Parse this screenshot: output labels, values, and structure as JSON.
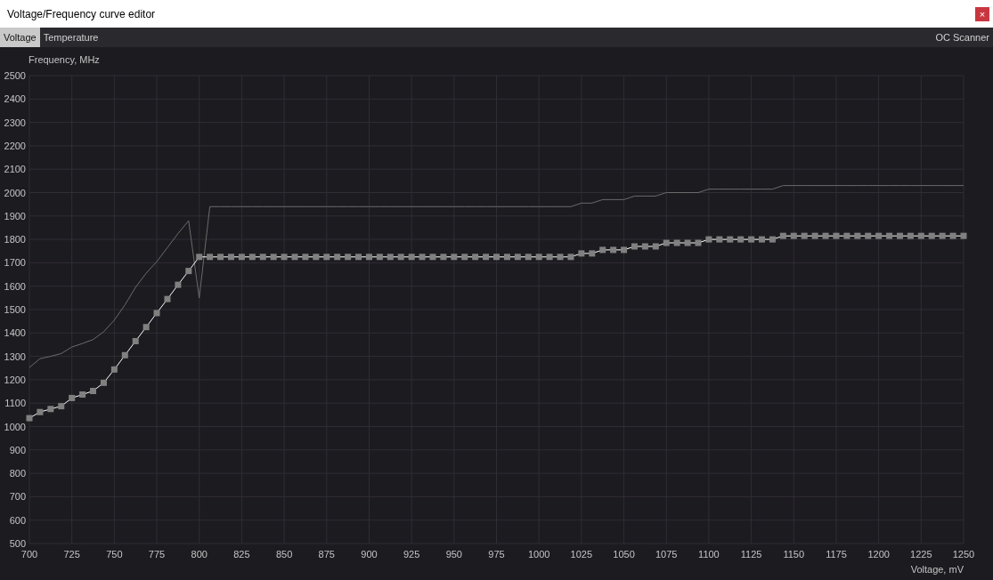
{
  "window": {
    "title": "Voltage/Frequency curve editor",
    "close": "×"
  },
  "tabs": [
    {
      "label": "Voltage",
      "selected": true
    },
    {
      "label": "Temperature",
      "selected": false
    }
  ],
  "oc_scanner": "OC Scanner",
  "chart_data": {
    "type": "line",
    "xlabel": "Voltage, mV",
    "ylabel": "Frequency, MHz",
    "grid": true,
    "xlim": [
      700,
      1250
    ],
    "ylim": [
      500,
      2500
    ],
    "xticks": [
      700,
      725,
      750,
      775,
      800,
      825,
      850,
      875,
      900,
      925,
      950,
      975,
      1000,
      1025,
      1050,
      1075,
      1100,
      1125,
      1150,
      1175,
      1200,
      1225,
      1250
    ],
    "yticks": [
      500,
      600,
      700,
      800,
      900,
      1000,
      1100,
      1200,
      1300,
      1400,
      1500,
      1600,
      1700,
      1800,
      1900,
      2000,
      2100,
      2200,
      2300,
      2400,
      2500
    ],
    "x": [
      700,
      706.25,
      712.5,
      718.75,
      725,
      731.25,
      737.5,
      743.75,
      750,
      756.25,
      762.5,
      768.75,
      775,
      781.25,
      787.5,
      793.75,
      800,
      806.25,
      812.5,
      818.75,
      825,
      831.25,
      837.5,
      843.75,
      850,
      856.25,
      862.5,
      868.75,
      875,
      881.25,
      887.5,
      893.75,
      900,
      906.25,
      912.5,
      918.75,
      925,
      931.25,
      937.5,
      943.75,
      950,
      956.25,
      962.5,
      968.75,
      975,
      981.25,
      987.5,
      993.75,
      1000,
      1006.25,
      1012.5,
      1018.75,
      1025,
      1031.25,
      1037.5,
      1043.75,
      1050,
      1056.25,
      1062.5,
      1068.75,
      1075,
      1081.25,
      1087.5,
      1093.75,
      1100,
      1106.25,
      1112.5,
      1118.75,
      1125,
      1131.25,
      1137.5,
      1143.75,
      1150,
      1156.25,
      1162.5,
      1168.75,
      1175,
      1181.25,
      1187.5,
      1193.75,
      1200,
      1206.25,
      1212.5,
      1218.75,
      1225,
      1231.25,
      1237.5,
      1243.75,
      1250
    ],
    "series": [
      {
        "color": "#ffffff",
        "marker": "square",
        "values": [
          1036,
          1062,
          1075,
          1087,
          1122,
          1137,
          1152,
          1187,
          1244,
          1305,
          1365,
          1425,
          1485,
          1545,
          1606,
          1665,
          1725,
          1725,
          1725,
          1725,
          1725,
          1725,
          1725,
          1725,
          1725,
          1725,
          1725,
          1725,
          1725,
          1725,
          1725,
          1725,
          1725,
          1725,
          1725,
          1725,
          1725,
          1725,
          1725,
          1725,
          1725,
          1725,
          1725,
          1725,
          1725,
          1725,
          1725,
          1725,
          1725,
          1725,
          1725,
          1725,
          1740,
          1740,
          1755,
          1755,
          1755,
          1770,
          1770,
          1770,
          1785,
          1785,
          1785,
          1785,
          1800,
          1800,
          1800,
          1800,
          1800,
          1800,
          1800,
          1815,
          1815,
          1815,
          1815,
          1815,
          1815,
          1815,
          1815,
          1815,
          1815,
          1815,
          1815,
          1815,
          1815,
          1815,
          1815,
          1815,
          1815
        ]
      },
      {
        "color": "#6b6b6b",
        "values": [
          1253,
          1290,
          1300,
          1312,
          1340,
          1355,
          1372,
          1405,
          1455,
          1520,
          1595,
          1655,
          1705,
          1765,
          1825,
          1880,
          1549,
          1940,
          1940,
          1940,
          1940,
          1940,
          1940,
          1940,
          1940,
          1940,
          1940,
          1940,
          1940,
          1940,
          1940,
          1940,
          1940,
          1940,
          1940,
          1940,
          1940,
          1940,
          1940,
          1940,
          1940,
          1940,
          1940,
          1940,
          1940,
          1940,
          1940,
          1940,
          1940,
          1940,
          1940,
          1940,
          1955,
          1955,
          1970,
          1970,
          1970,
          1985,
          1985,
          1985,
          2000,
          2000,
          2000,
          2000,
          2015,
          2015,
          2015,
          2015,
          2015,
          2015,
          2015,
          2030,
          2030,
          2030,
          2030,
          2030,
          2030,
          2030,
          2030,
          2030,
          2030,
          2030,
          2030,
          2030,
          2030,
          2030,
          2030,
          2030,
          2030
        ]
      }
    ]
  }
}
